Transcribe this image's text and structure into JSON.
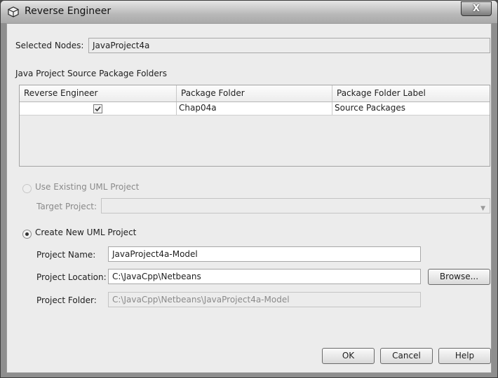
{
  "window": {
    "title": "Reverse Engineer",
    "close_label": "X"
  },
  "selected_nodes": {
    "label": "Selected Nodes:",
    "value": "JavaProject4a"
  },
  "source_folders": {
    "heading": "Java Project Source Package Folders",
    "columns": [
      "Reverse Engineer",
      "Package Folder",
      "Package Folder Label"
    ],
    "rows": [
      {
        "checked": true,
        "package_folder": "Chap04a",
        "package_folder_label": "Source Packages"
      }
    ]
  },
  "use_existing": {
    "label": "Use Existing UML Project",
    "selected": false,
    "enabled": false,
    "target_project_label": "Target Project:",
    "target_project_value": ""
  },
  "create_new": {
    "label": "Create New UML Project",
    "selected": true,
    "project_name_label": "Project Name:",
    "project_name_value": "JavaProject4a-Model",
    "project_location_label": "Project Location:",
    "project_location_value": "C:\\JavaCpp\\Netbeans",
    "browse_label": "Browse...",
    "project_folder_label": "Project Folder:",
    "project_folder_value": "C:\\JavaCpp\\Netbeans\\JavaProject4a-Model"
  },
  "buttons": {
    "ok": "OK",
    "cancel": "Cancel",
    "help": "Help"
  },
  "icons": {
    "title": "netbeans-cube-icon",
    "close": "close-icon",
    "checkbox": "checkmark-icon",
    "combo": "chevron-down-icon"
  }
}
